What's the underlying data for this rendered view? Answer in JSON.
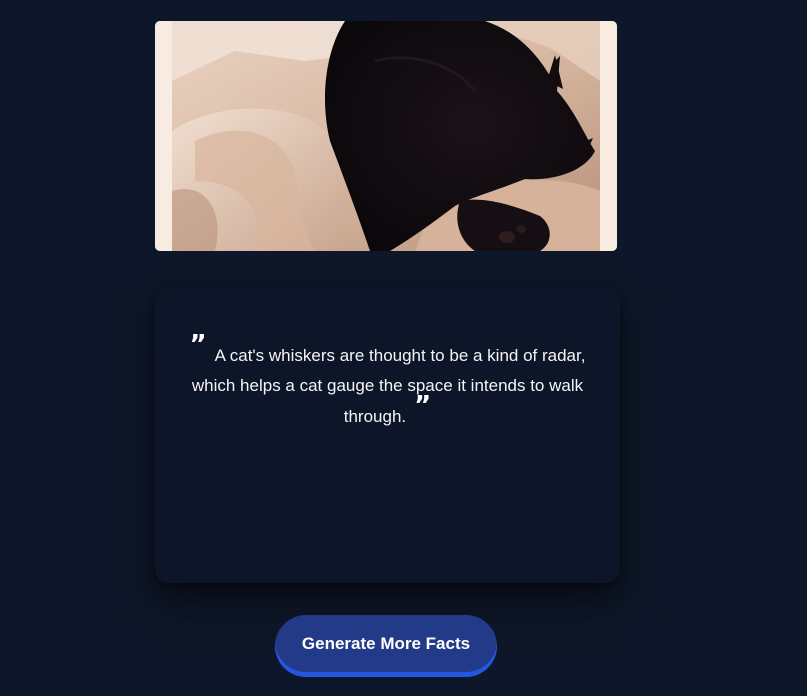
{
  "photo": {
    "alt": "Black cat sleeping on white sheets",
    "icon": "cat-photo"
  },
  "fact": {
    "open_quote": "”",
    "text": "A cat's whiskers are thought to be a kind of radar, which helps a cat gauge the space it intends to walk through.",
    "close_quote": "”"
  },
  "actions": {
    "generate_label": "Generate More Facts"
  },
  "colors": {
    "background": "#0e1729",
    "card": "#0d1628",
    "button": "#223a88",
    "button_accent": "#2457e0"
  }
}
